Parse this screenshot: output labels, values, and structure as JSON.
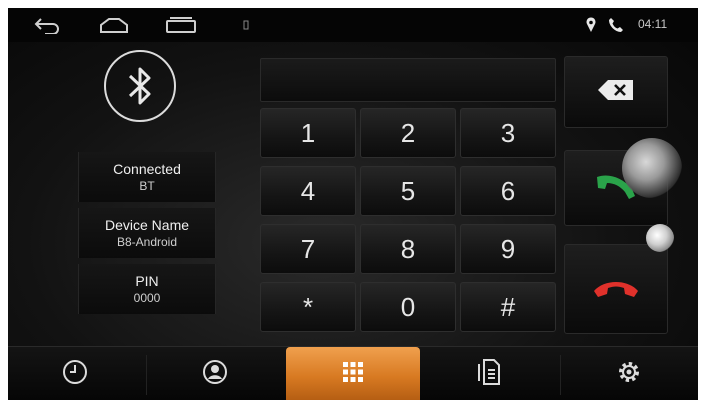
{
  "status_bar": {
    "time": "04:11",
    "icons": [
      "back-icon",
      "home-icon",
      "recent-apps-icon",
      "notification-dot-icon",
      "location-pin-icon",
      "phone-icon"
    ]
  },
  "device_info": {
    "bluetooth_icon": "bluetooth-icon",
    "connection": {
      "label": "Connected",
      "value": "BT"
    },
    "device_name": {
      "label": "Device Name",
      "value": "B8-Android"
    },
    "pin": {
      "label": "PIN",
      "value": "0000"
    }
  },
  "dialer": {
    "number_display": "",
    "keys": [
      "1",
      "2",
      "3",
      "4",
      "5",
      "6",
      "7",
      "8",
      "9",
      "*",
      "0",
      "#"
    ]
  },
  "controls": {
    "backspace_icon": "backspace-icon",
    "call_icon": "call-icon",
    "hangup_icon": "hang-up-icon",
    "call_color": "#2aa34a",
    "hangup_color": "#e0312b"
  },
  "nav": {
    "items": [
      {
        "name": "recents",
        "icon": "clock-icon",
        "active": false
      },
      {
        "name": "contacts",
        "icon": "contact-icon",
        "active": false
      },
      {
        "name": "dialpad",
        "icon": "dialpad-icon",
        "active": true
      },
      {
        "name": "call-log",
        "icon": "call-log-icon",
        "active": false
      },
      {
        "name": "settings",
        "icon": "gear-icon",
        "active": false
      }
    ],
    "active_color": "#e08a2c"
  }
}
